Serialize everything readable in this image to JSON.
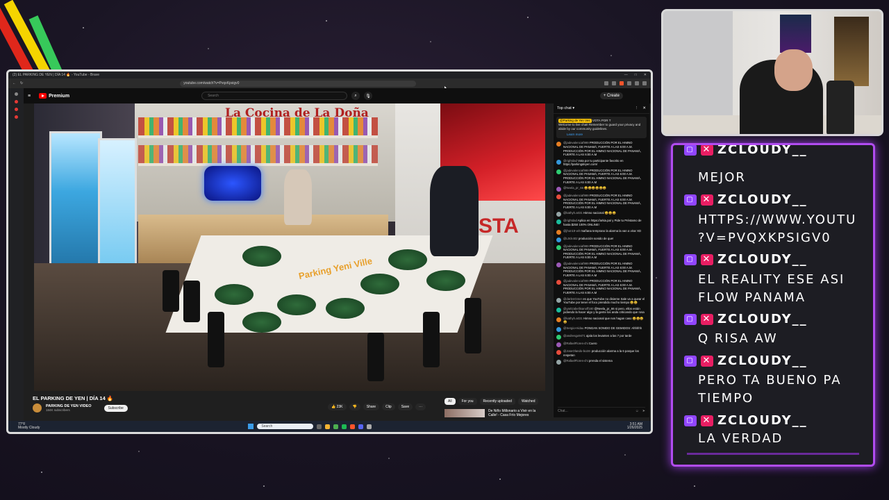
{
  "browser": {
    "window_title": "(2) EL PARKING DE YEN | DÍA 14 🔥 - YouTube - Brave",
    "url": "youtube.com/watch?v=PvqxKpsigv0"
  },
  "youtube": {
    "logo_text": "Premium",
    "search_placeholder": "Search",
    "create_label": "+ Create",
    "video_title": "EL PARKING DE YEN | DÍA 14 🔥",
    "channel_name": "PARKING DE YEN VIDEO",
    "subscribers": "184K subscribers",
    "subscribe_label": "Subscribe",
    "actions": [
      "👍 23K",
      "👎",
      "Share",
      "Clip",
      "Save",
      "⋯"
    ],
    "chips": [
      "All",
      "For you",
      "Recently uploaded",
      "Watched"
    ],
    "recommended_title": "De Niño Millonario a Vivir en la Calle! - Casa Frío Mejores",
    "scene": {
      "sign": "La Cocina de La Doña",
      "table_text": "Parking Yeni Ville",
      "staplus": "STA"
    }
  },
  "chat": {
    "header": "Top chat ▾",
    "pinned_user": "@Parking de Yen Ves",
    "pinned_badge": "VOTA POR T",
    "pinned_text": "Welcome to live chat! Remember to guard your privacy and abide by our community guidelines.",
    "learn_more": "Learn more",
    "messages": [
      {
        "user": "@jadevalenciaf999",
        "text": "PRODUCCIÓN POR EL HIMNO NACIONAL DE PANAMÁ, FUERTE A LAS 6:00 A.M. PRODUCCIÓN POR EL HIMNO NACIONAL DE PANAMÁ, FUERTE A LAS 6:00 A.M"
      },
      {
        "user": "@rightdad",
        "text": "Vota por tu participante favorito en https://parkingdeyen.com/"
      },
      {
        "user": "@jadevalenciaf999",
        "text": "PRODUCCIÓN POR EL HIMNO NACIONAL DE PANAMÁ, FUERTE A LAS 6:00 A.M. PRODUCCIÓN POR EL HIMNO NACIONAL DE PANAMÁ, FUERTE A LAS 6:00 A.M"
      },
      {
        "user": "@Neela_pr_66",
        "text": "😄😄😄😄😄😄"
      },
      {
        "user": "@jadevalenciaf999",
        "text": "PRODUCCIÓN POR EL HIMNO NACIONAL DE PANAMÁ, FUERTE A LAS 6:00 A.M. PRODUCCIÓN POR EL HIMNO NACIONAL DE PANAMÁ, FUERTE A LAS 6:00 A.M"
      },
      {
        "user": "@kathyh.a031",
        "text": "Himno nacional 😄😄😄"
      },
      {
        "user": "@rightdad",
        "text": "Aplica en https://arkia.pa/ y Pide tu Préstamo de hasta $250 100% ONLINE!"
      },
      {
        "user": "@jhon19-wlr",
        "text": "mañana temprano la alarma la van a virar XD"
      },
      {
        "user": "@L0ck402",
        "text": "producción sonido de que!"
      },
      {
        "user": "@jadevalenciaf999",
        "text": "PRODUCCIÓN POR EL HIMNO NACIONAL DE PANAMÁ, FUERTE A LAS 6:00 A.M. PRODUCCIÓN POR EL HIMNO NACIONAL DE PANAMÁ, FUERTE A LAS 6:00 A.M"
      },
      {
        "user": "@jadevalenciaf999",
        "text": "PRODUCCIÓN POR EL HIMNO NACIONAL DE PANAMÁ, FUERTE A LAS 6:00 A.M. PRODUCCIÓN POR EL HIMNO NACIONAL DE PANAMÁ, FUERTE A LAS 6:00 A.M"
      },
      {
        "user": "@jadevalenciaf999",
        "text": "PRODUCCIÓN POR EL HIMNO NACIONAL DE PANAMÁ, FUERTE A LAS 6:00 A.M. PRODUCCIÓN POR EL HIMNO NACIONAL DE PANAMÁ, FUERTE A LAS 6:00 A.M"
      },
      {
        "user": "@darlenGmer",
        "text": "es que YouTube no disierne Sale va a quear el YouTube por tener el foco prendido mucho tiempo 😄😄"
      },
      {
        "user": "@yaritzabellisanoff180",
        "text": "@Neela_pr_66 si pero, ellos están jodiendo la hacer algo y la gente los anda criticando que rosa"
      },
      {
        "user": "@kathyh.a031",
        "text": "Himno nacional que nos hagan caso 😄😄😄😄"
      },
      {
        "user": "@Sergio-Hidau",
        "text": "PONGAN SONIDO DE GEMIDOS: Ahhhhh"
      },
      {
        "user": "@andresgo9471",
        "text": "ajala los levanten a las 7 por tarde"
      },
      {
        "user": "@RafaelFlores-chi",
        "text": "Cuero"
      },
      {
        "user": "@JoseOlando-bo2m",
        "text": "producción alarma a la 6 parque los respetan"
      },
      {
        "user": "@RafaelFlores-chi",
        "text": "prenda el sistema"
      }
    ],
    "input_placeholder": "Chat..."
  },
  "taskbar": {
    "weather_temp": "77°F",
    "weather_desc": "Mostly Cloudy",
    "search": "Search",
    "time": "3:51 AM",
    "date": "1/26/2025"
  },
  "twitch": {
    "lines": [
      {
        "type": "text",
        "text": "ZCLOUDY__"
      },
      {
        "type": "text",
        "text": "MEJOR"
      },
      {
        "type": "name",
        "text": "ZCLOUDY__"
      },
      {
        "type": "text",
        "text": "HTTPS://WWW.YOUTU"
      },
      {
        "type": "text",
        "text": "?V=PVQXKPSIGV0"
      },
      {
        "type": "name",
        "text": "ZCLOUDY__"
      },
      {
        "type": "text",
        "text": "EL REALITY ESE ASI"
      },
      {
        "type": "text",
        "text": "FLOW PANAMA"
      },
      {
        "type": "name",
        "text": "ZCLOUDY__"
      },
      {
        "type": "text",
        "text": "Q RISA AW"
      },
      {
        "type": "name",
        "text": "ZCLOUDY__"
      },
      {
        "type": "text",
        "text": "PERO TA BUENO PA"
      },
      {
        "type": "text",
        "text": "TIEMPO"
      },
      {
        "type": "name",
        "text": "ZCLOUDY__"
      },
      {
        "type": "text",
        "text": "LA VERDAD"
      }
    ]
  },
  "colors": {
    "twitch_border": "#b14cf0",
    "yt_red": "#ff0000",
    "stripe_red": "#e0271b",
    "stripe_yellow": "#f5d400",
    "stripe_green": "#37c95a"
  }
}
